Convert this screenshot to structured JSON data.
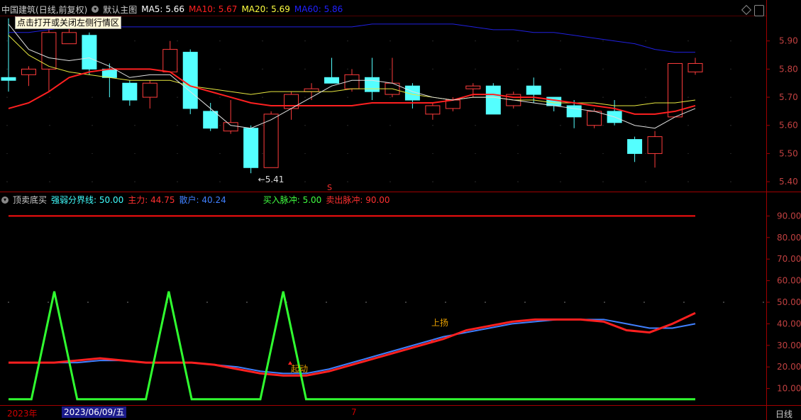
{
  "header": {
    "stock_name": "中国建筑",
    "period_info": "(日线,前复权)",
    "main_chart_label": "默认主图",
    "ma": [
      {
        "label": "MA5:",
        "value": "5.66",
        "color": "#ffffff"
      },
      {
        "label": "MA10:",
        "value": "5.67",
        "color": "#ff2020"
      },
      {
        "label": "MA20:",
        "value": "5.69",
        "color": "#ffff40"
      },
      {
        "label": "MA60:",
        "value": "5.86",
        "color": "#2020ff"
      }
    ],
    "tooltip": "点击打开或关闭左侧行情区"
  },
  "price_axis": {
    "ticks": [
      "5.90",
      "5.80",
      "5.70",
      "5.60",
      "5.50",
      "5.40"
    ],
    "min_label": "←5.41"
  },
  "indicator": {
    "name": "顶卖底买",
    "params": [
      {
        "label": "强弱分界线:",
        "value": "50.00",
        "color": "#40ffff"
      },
      {
        "label": "主力:",
        "value": "44.75",
        "color": "#ff3030"
      },
      {
        "label": "散户:",
        "value": "40.24",
        "color": "#4080ff"
      },
      {
        "label": "买入脉冲:",
        "value": "5.00",
        "color": "#40ff40"
      },
      {
        "label": "卖出脉冲:",
        "value": "90.00",
        "color": "#ff3030"
      }
    ],
    "ticks": [
      "90.00",
      "80.00",
      "70.00",
      "60.00",
      "50.00",
      "40.00",
      "30.00",
      "20.00",
      "10.00"
    ],
    "annotations": [
      {
        "text": "起动"
      },
      {
        "text": "上扬"
      }
    ],
    "signal_mark": "S"
  },
  "footer": {
    "year": "2023年",
    "date": "2023/06/09/五",
    "month": "7",
    "period": "日线"
  },
  "chart_data": {
    "type": "candlestick",
    "candles": [
      [
        5.77,
        5.76,
        5.98,
        5.72
      ],
      [
        5.78,
        5.8,
        5.81,
        5.74
      ],
      [
        5.8,
        5.93,
        5.95,
        5.72
      ],
      [
        5.89,
        5.93,
        5.96,
        5.89
      ],
      [
        5.92,
        5.8,
        5.93,
        5.78
      ],
      [
        5.8,
        5.77,
        5.82,
        5.7
      ],
      [
        5.75,
        5.69,
        5.76,
        5.67
      ],
      [
        5.7,
        5.75,
        5.76,
        5.66
      ],
      [
        5.79,
        5.87,
        5.9,
        5.79
      ],
      [
        5.86,
        5.66,
        5.87,
        5.64
      ],
      [
        5.65,
        5.59,
        5.68,
        5.58
      ],
      [
        5.58,
        5.61,
        5.69,
        5.57
      ],
      [
        5.59,
        5.45,
        5.6,
        5.43
      ],
      [
        5.45,
        5.64,
        5.65,
        5.45
      ],
      [
        5.66,
        5.71,
        5.72,
        5.62
      ],
      [
        5.72,
        5.73,
        5.75,
        5.69
      ],
      [
        5.77,
        5.75,
        5.84,
        5.75
      ],
      [
        5.73,
        5.78,
        5.8,
        5.72
      ],
      [
        5.77,
        5.72,
        5.84,
        5.69
      ],
      [
        5.71,
        5.75,
        5.84,
        5.7
      ],
      [
        5.74,
        5.69,
        5.75,
        5.66
      ],
      [
        5.64,
        5.67,
        5.68,
        5.62
      ],
      [
        5.66,
        5.69,
        5.7,
        5.65
      ],
      [
        5.73,
        5.74,
        5.75,
        5.7
      ],
      [
        5.74,
        5.64,
        5.75,
        5.64
      ],
      [
        5.67,
        5.71,
        5.72,
        5.66
      ],
      [
        5.74,
        5.71,
        5.77,
        5.68
      ],
      [
        5.7,
        5.67,
        5.7,
        5.65
      ],
      [
        5.67,
        5.63,
        5.69,
        5.59
      ],
      [
        5.6,
        5.65,
        5.66,
        5.59
      ],
      [
        5.65,
        5.61,
        5.69,
        5.6
      ],
      [
        5.55,
        5.5,
        5.56,
        5.47
      ],
      [
        5.5,
        5.56,
        5.58,
        5.45
      ],
      [
        5.63,
        5.82,
        5.82,
        5.63
      ],
      [
        5.79,
        5.82,
        5.84,
        5.78
      ]
    ],
    "ma5": [
      5.96,
      5.87,
      5.84,
      5.83,
      5.84,
      5.81,
      5.77,
      5.78,
      5.78,
      5.72,
      5.66,
      5.6,
      5.59,
      5.62,
      5.66,
      5.7,
      5.74,
      5.76,
      5.76,
      5.75,
      5.72,
      5.7,
      5.69,
      5.7,
      5.7,
      5.69,
      5.68,
      5.67,
      5.66,
      5.65,
      5.63,
      5.6,
      5.59,
      5.63,
      5.66
    ],
    "ma10": [
      5.66,
      5.68,
      5.72,
      5.77,
      5.79,
      5.8,
      5.8,
      5.8,
      5.79,
      5.74,
      5.72,
      5.7,
      5.68,
      5.67,
      5.67,
      5.67,
      5.67,
      5.67,
      5.68,
      5.68,
      5.68,
      5.68,
      5.69,
      5.71,
      5.71,
      5.7,
      5.7,
      5.69,
      5.68,
      5.67,
      5.66,
      5.64,
      5.64,
      5.65,
      5.67
    ],
    "ma20": [
      5.92,
      5.85,
      5.81,
      5.79,
      5.78,
      5.77,
      5.76,
      5.76,
      5.76,
      5.74,
      5.73,
      5.72,
      5.71,
      5.72,
      5.72,
      5.72,
      5.72,
      5.73,
      5.73,
      5.73,
      5.71,
      5.7,
      5.69,
      5.7,
      5.7,
      5.69,
      5.69,
      5.68,
      5.68,
      5.68,
      5.67,
      5.67,
      5.68,
      5.68,
      5.69
    ],
    "ma60": [
      5.93,
      5.93,
      5.94,
      5.95,
      5.95,
      5.95,
      5.95,
      5.95,
      5.95,
      5.95,
      5.95,
      5.95,
      5.95,
      5.95,
      5.95,
      5.95,
      5.95,
      5.95,
      5.96,
      5.96,
      5.96,
      5.96,
      5.96,
      5.95,
      5.94,
      5.94,
      5.93,
      5.93,
      5.92,
      5.91,
      5.9,
      5.89,
      5.87,
      5.86,
      5.86
    ],
    "price_ylim": [
      5.37,
      5.99
    ],
    "ind_ylim": [
      0,
      100
    ],
    "zhuli": [
      22,
      22,
      22,
      23,
      24,
      23,
      22,
      22,
      22,
      21,
      19,
      17,
      16,
      16,
      18,
      21,
      24,
      27,
      30,
      33,
      37,
      39,
      41,
      42,
      42,
      42,
      41,
      37,
      36,
      40,
      45
    ],
    "sanhu": [
      22,
      22,
      22,
      22,
      23,
      23,
      22,
      22,
      22,
      21,
      20,
      18,
      17,
      17,
      19,
      22,
      25,
      28,
      31,
      34,
      36,
      38,
      40,
      41,
      42,
      42,
      42,
      40,
      38,
      38,
      40
    ],
    "buy_pulse": [
      5,
      5,
      55,
      5,
      5,
      5,
      5,
      55,
      5,
      5,
      5,
      5,
      55,
      5,
      5,
      5,
      5,
      5,
      5,
      5,
      5,
      5,
      5,
      5,
      5,
      5,
      5,
      5,
      5,
      5,
      5
    ],
    "sell_line": 90
  }
}
